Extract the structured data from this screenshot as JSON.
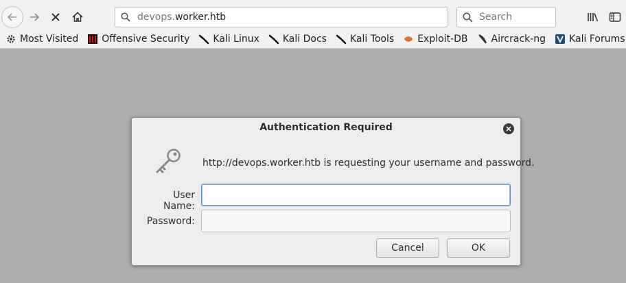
{
  "browser": {
    "url_host": "devops.",
    "url_domain": "worker.htb",
    "search_placeholder": "Search",
    "icons": {
      "back": "back-arrow-icon",
      "forward": "forward-arrow-icon",
      "stop": "stop-icon",
      "home": "home-icon",
      "url_search": "search-icon",
      "library": "library-icon",
      "sidebar": "sidebar-icon"
    }
  },
  "bookmarks": [
    {
      "label": "Most Visited",
      "icon": "gear-icon"
    },
    {
      "label": "Offensive Security",
      "icon": "offsec-icon"
    },
    {
      "label": "Kali Linux",
      "icon": "kali-dragon-icon"
    },
    {
      "label": "Kali Docs",
      "icon": "kali-dragon-icon"
    },
    {
      "label": "Kali Tools",
      "icon": "kali-dragon-icon"
    },
    {
      "label": "Exploit-DB",
      "icon": "exploitdb-icon"
    },
    {
      "label": "Aircrack-ng",
      "icon": "aircrack-icon"
    },
    {
      "label": "Kali Forums",
      "icon": "kali-forums-icon"
    }
  ],
  "dialog": {
    "title": "Authentication Required",
    "message": "http://devops.worker.htb is requesting your username and password.",
    "username_label": "User Name:",
    "password_label": "Password:",
    "username_value": "",
    "password_value": "",
    "cancel_label": "Cancel",
    "ok_label": "OK",
    "icon": "key-icon"
  },
  "colors": {
    "toolbar_bg": "#f1f1f1",
    "content_bg": "#aeaeae",
    "dialog_bg": "#ededed",
    "focus_border": "#5b8fc7"
  }
}
